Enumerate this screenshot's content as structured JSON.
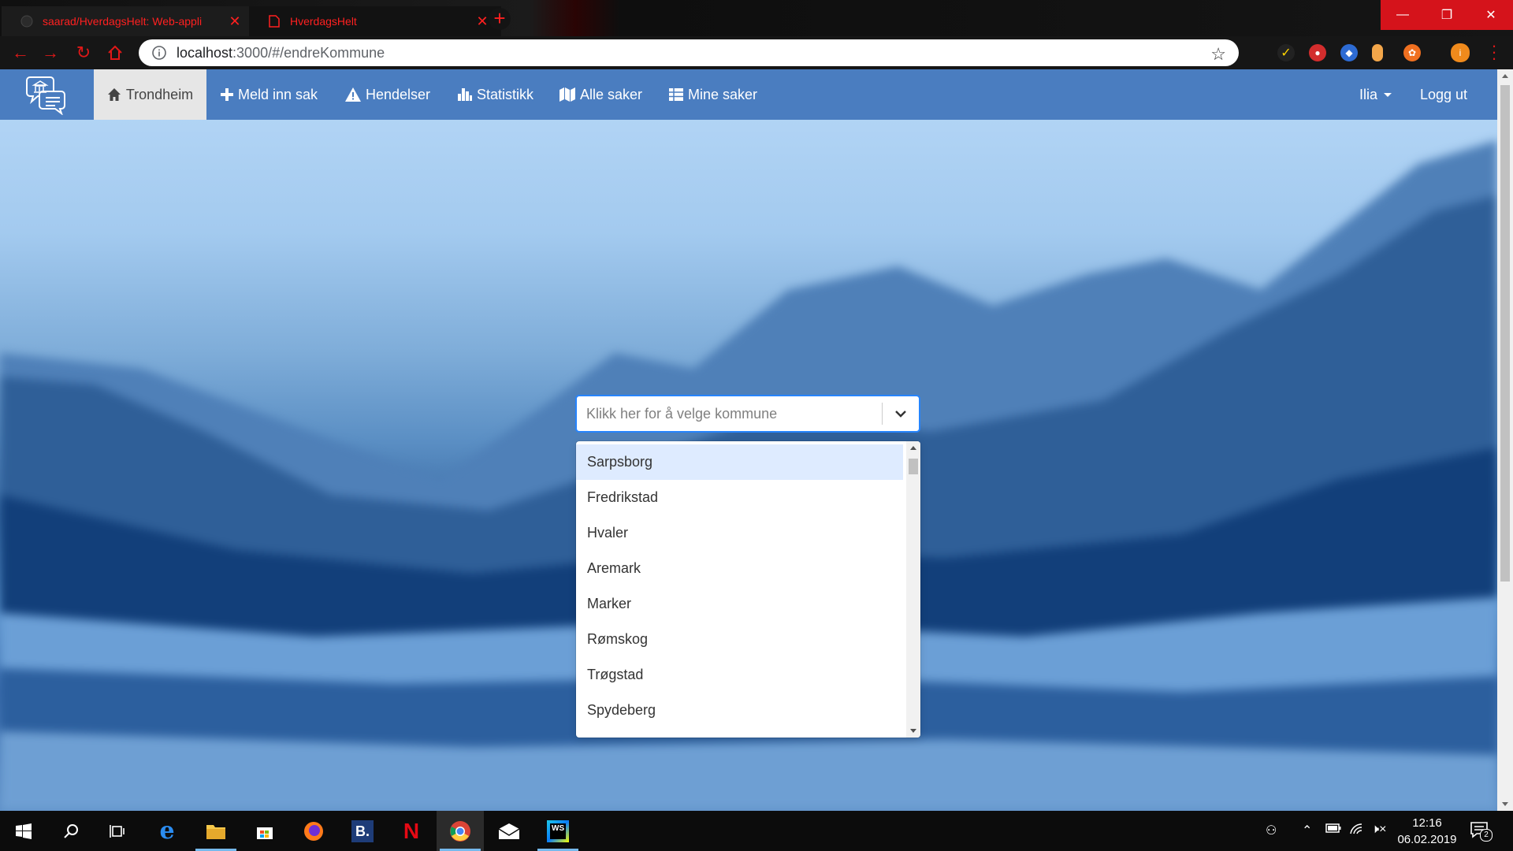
{
  "browser": {
    "tabs": [
      {
        "title": "saarad/HverdagsHelt: Web-appli",
        "active": false
      },
      {
        "title": "HverdagsHelt",
        "active": true
      }
    ],
    "url_host": "localhost",
    "url_rest": ":3000/#/endreKommune",
    "window_controls": {
      "minimize": "—",
      "maximize": "❐",
      "close": "✕"
    }
  },
  "appnav": {
    "items": [
      {
        "label": "Trondheim",
        "icon": "home-icon"
      },
      {
        "label": "Meld inn sak",
        "icon": "plus-icon"
      },
      {
        "label": "Hendelser",
        "icon": "warning-icon"
      },
      {
        "label": "Statistikk",
        "icon": "bar-chart-icon"
      },
      {
        "label": "Alle saker",
        "icon": "map-icon"
      },
      {
        "label": "Mine saker",
        "icon": "table-icon"
      }
    ],
    "user": "Ilia",
    "logout": "Logg ut"
  },
  "select": {
    "placeholder": "Klikk her for å velge kommune",
    "options": [
      "Sarpsborg",
      "Fredrikstad",
      "Hvaler",
      "Aremark",
      "Marker",
      "Rømskog",
      "Trøgstad",
      "Spydeberg"
    ],
    "focused_option": "Sarpsborg"
  },
  "taskbar": {
    "time": "12:16",
    "date": "06.02.2019",
    "notification_count": "2",
    "pinned": [
      "start-icon",
      "search-icon",
      "task-view-icon",
      "edge-icon",
      "file-explorer-icon",
      "store-icon",
      "firefox-icon",
      "booking-icon",
      "netflix-icon",
      "chrome-icon",
      "mail-icon",
      "webstorm-icon"
    ],
    "active_app": "chrome-icon"
  },
  "colors": {
    "nav_bg": "#4a7dc0",
    "nav_active_bg": "#e6e6e6",
    "chrome_accent": "#e01818",
    "focused_option_bg": "#deebff",
    "select_focus_border": "#2684ff"
  }
}
